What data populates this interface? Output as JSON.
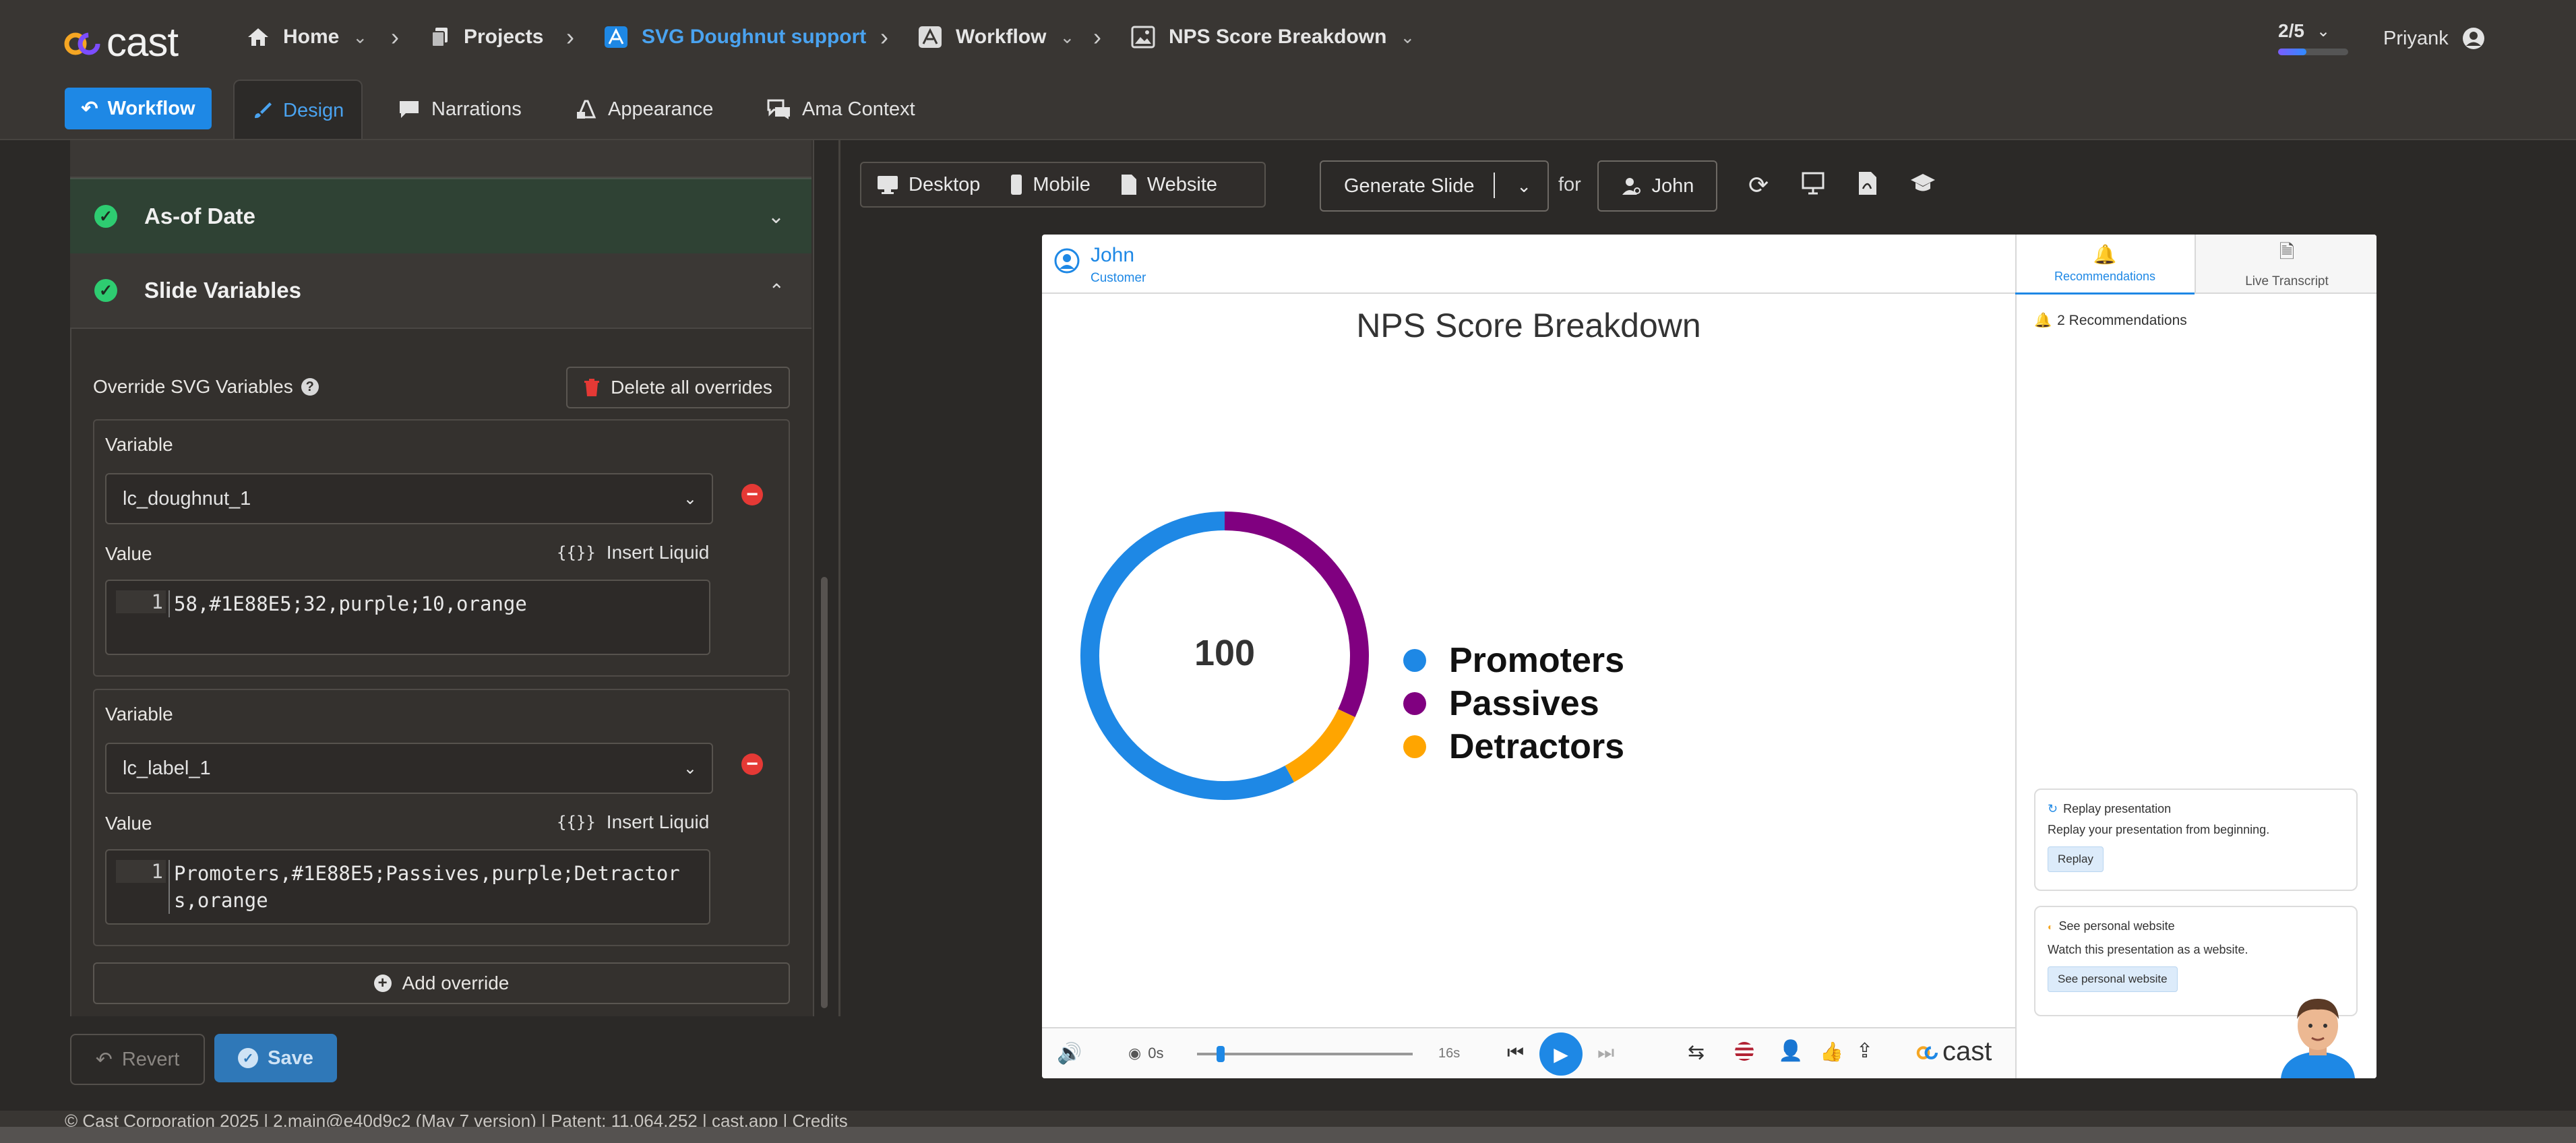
{
  "nav": {
    "logo_text": "cast",
    "home": "Home",
    "projects": "Projects",
    "project_name": "SVG Doughnut support",
    "workflow": "Workflow",
    "slide_name": "NPS Score Breakdown",
    "progress": "2/5",
    "progress_fraction": 0.4,
    "user": "Priyank"
  },
  "tabs": {
    "workflow_button": "Workflow",
    "items": [
      "Design",
      "Narrations",
      "Appearance",
      "Ama Context"
    ],
    "active": "Design"
  },
  "panel": {
    "asof_title": "As-of Date",
    "slide_vars_title": "Slide Variables",
    "override_label": "Override SVG Variables",
    "delete_all": "Delete all overrides",
    "variable_label": "Variable",
    "value_label": "Value",
    "insert_liquid": "Insert Liquid",
    "liquid_glyph": "{{}}",
    "overrides": [
      {
        "variable": "lc_doughnut_1",
        "line_no": "1",
        "value": "58,#1E88E5;32,purple;10,orange"
      },
      {
        "variable": "lc_label_1",
        "line_no": "1",
        "value": "Promoters,#1E88E5;Passives,purple;Detractors,orange"
      }
    ],
    "add_override": "Add override",
    "revert": "Revert",
    "save": "Save"
  },
  "footer": "© Cast Corporation 2025 | 2.main@e40d9c2 (May 7 version) | Patent: 11,064,252 | cast.app | Credits",
  "toolbar": {
    "desktop": "Desktop",
    "mobile": "Mobile",
    "website": "Website",
    "generate": "Generate Slide",
    "for": "for",
    "audience": "John"
  },
  "slide": {
    "viewer_name": "John",
    "viewer_role": "Customer",
    "title": "NPS Score Breakdown",
    "time_start": "0s",
    "time_end": "16s",
    "playhead_fraction": 0.09,
    "brand": "cast"
  },
  "chart_data": {
    "type": "pie",
    "center_label": "100",
    "categories": [
      "Promoters",
      "Passives",
      "Detractors"
    ],
    "values": [
      58,
      32,
      10
    ],
    "colors": [
      "#1E88E5",
      "purple",
      "orange"
    ]
  },
  "sidebar": {
    "tab_recommendations": "Recommendations",
    "tab_transcript": "Live Transcript",
    "rec_count": "2 Recommendations",
    "cards": [
      {
        "title": "Replay presentation",
        "text": "Replay your presentation from beginning.",
        "button": "Replay"
      },
      {
        "title": "See personal website",
        "text": "Watch this presentation as a website.",
        "button": "See personal website"
      }
    ]
  }
}
